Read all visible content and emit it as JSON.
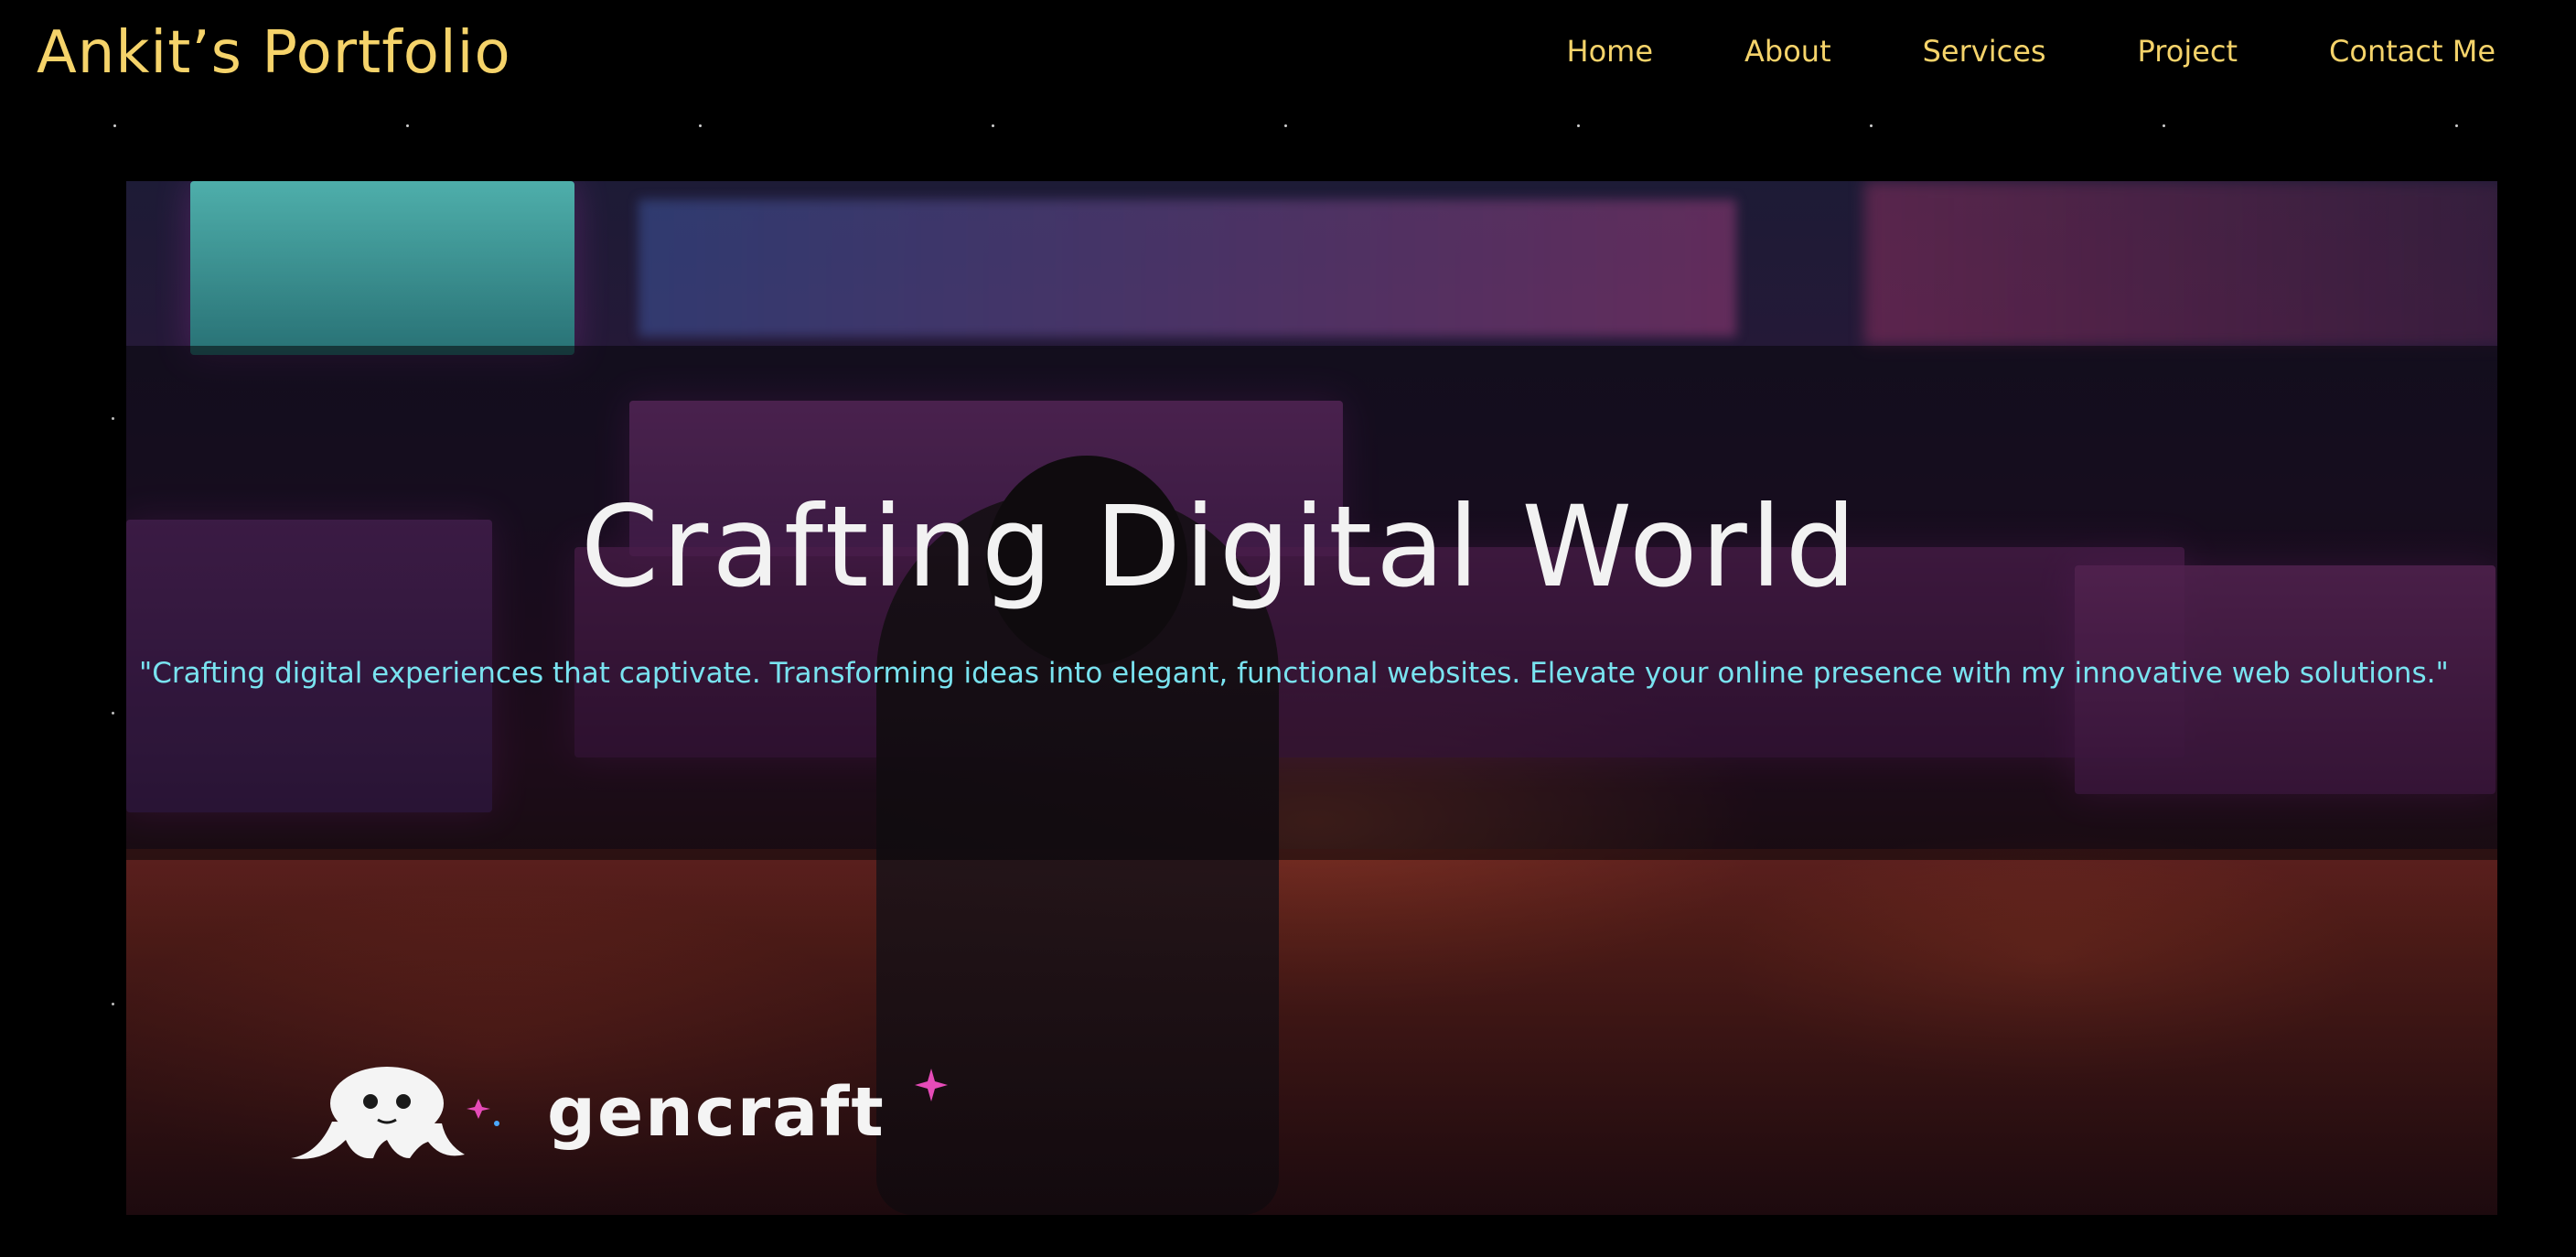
{
  "header": {
    "brand": "Ankit’s Portfolio",
    "nav": [
      {
        "label": "Home"
      },
      {
        "label": "About"
      },
      {
        "label": "Services"
      },
      {
        "label": "Project"
      },
      {
        "label": "Contact Me"
      }
    ]
  },
  "hero": {
    "title": "Crafting Digital World",
    "tagline": "\"Crafting digital experiences that captivate. Transforming ideas into elegant, functional websites. Elevate your online presence with my innovative web solutions.\"",
    "watermark": {
      "text": "gencraft",
      "icon": "octopus-logo-icon"
    }
  },
  "colors": {
    "accent": "#f5d36a",
    "tagline": "#79e3f0",
    "background": "#000000"
  }
}
